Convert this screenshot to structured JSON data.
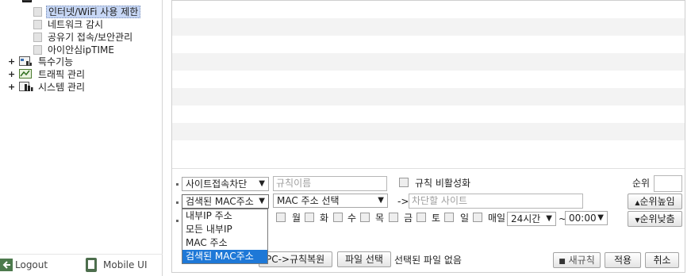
{
  "sidebar": {
    "subitems": [
      {
        "label": "인터넷/WiFi 사용 제한",
        "selected": true
      },
      {
        "label": "네트워크 감시",
        "selected": false
      },
      {
        "label": "공유기 접속/보안관리",
        "selected": false
      },
      {
        "label": "아이안심ipTIME",
        "selected": false
      }
    ],
    "categories": [
      {
        "toggle": "+",
        "icon": "special-features-icon",
        "label": "특수기능"
      },
      {
        "toggle": "+",
        "icon": "traffic-chart-icon",
        "label": "트래픽 관리"
      },
      {
        "toggle": "+",
        "icon": "system-bars-icon",
        "label": "시스템 관리"
      }
    ],
    "footer": {
      "logout": "Logout",
      "mobile": "Mobile UI"
    }
  },
  "form": {
    "rule_type": "사이트접속차단",
    "rule_name_placeholder": "규칙이름",
    "disable_rule_label": "규칙 비활성화",
    "priority_label": "순위",
    "priority_value": "",
    "source_select": "검색된 MAC주소",
    "mac_select": "MAC 주소 선택",
    "arrow": "->",
    "site_placeholder": "차단할 사이트",
    "priority_up": "순위높임",
    "priority_down": "순위낮춤",
    "days": [
      "월",
      "화",
      "수",
      "목",
      "금",
      "토",
      "일",
      "매일"
    ],
    "time_select": "24시간",
    "time_sep": "~",
    "time_end": "00:00",
    "restore_button": "PC->규칙복원",
    "file_button": "파일 선택",
    "file_status": "선택된 파일 없음",
    "new_rule_button": "새규칙",
    "apply_button": "적용",
    "cancel_button": "취소"
  },
  "dropdown": {
    "options": [
      "내부IP 주소",
      "모든 내부IP",
      "MAC 주소",
      "검색된 MAC주소"
    ],
    "selected_index": 3
  },
  "colors": {
    "selection": "#1e78d7",
    "tree_highlight": "#c7d7f5",
    "stripe": "#f3f3f3"
  }
}
